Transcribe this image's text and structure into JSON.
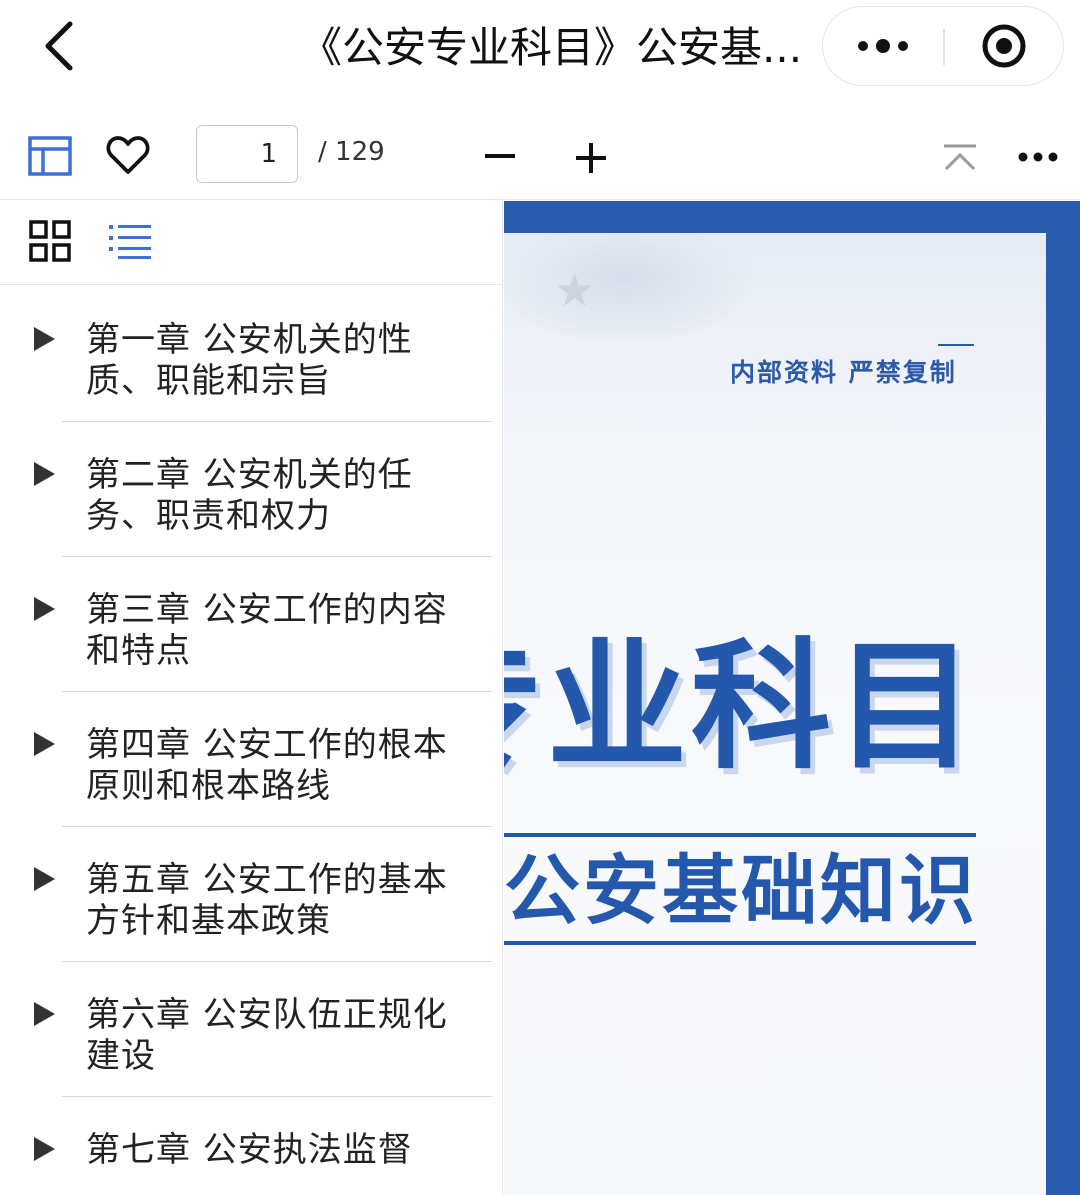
{
  "titlebar": {
    "title": "《公安专业科目》公安基...",
    "back_icon": "chevron-left-icon",
    "more_icon": "more-dots-icon",
    "close_icon": "target-circle-icon"
  },
  "toolbar": {
    "outline_icon": "layout-panel-icon",
    "favorite_icon": "heart-icon",
    "page_current": "1",
    "page_total": "/ 129",
    "zoom_out_icon": "minus-icon",
    "zoom_in_icon": "plus-icon",
    "scroll_top_icon": "scroll-to-top-icon",
    "more_icon": "more-dots-icon",
    "accent_color": "#3f6fd8"
  },
  "sidebar": {
    "tabs": [
      {
        "name": "thumbnail-grid",
        "icon": "grid-icon",
        "active": false
      },
      {
        "name": "outline-list",
        "icon": "list-icon",
        "active": true
      }
    ],
    "items": [
      {
        "label": "第一章 公安机关的性质、职能和宗旨"
      },
      {
        "label": "第二章 公安机关的任务、职责和权力"
      },
      {
        "label": "第三章 公安工作的内容和特点"
      },
      {
        "label": "第四章 公安工作的根本原则和根本路线"
      },
      {
        "label": "第五章 公安工作的基本方针和基本政策"
      },
      {
        "label": "第六章 公安队伍正规化建设"
      },
      {
        "label": "第七章 公安执法监督"
      }
    ]
  },
  "document": {
    "internal_notice": "内部资料  严禁复制",
    "big_title": "专业科目",
    "subtitle": "公安基础知识",
    "brand_color": "#2358ad",
    "frame_color": "#2a5cae"
  }
}
